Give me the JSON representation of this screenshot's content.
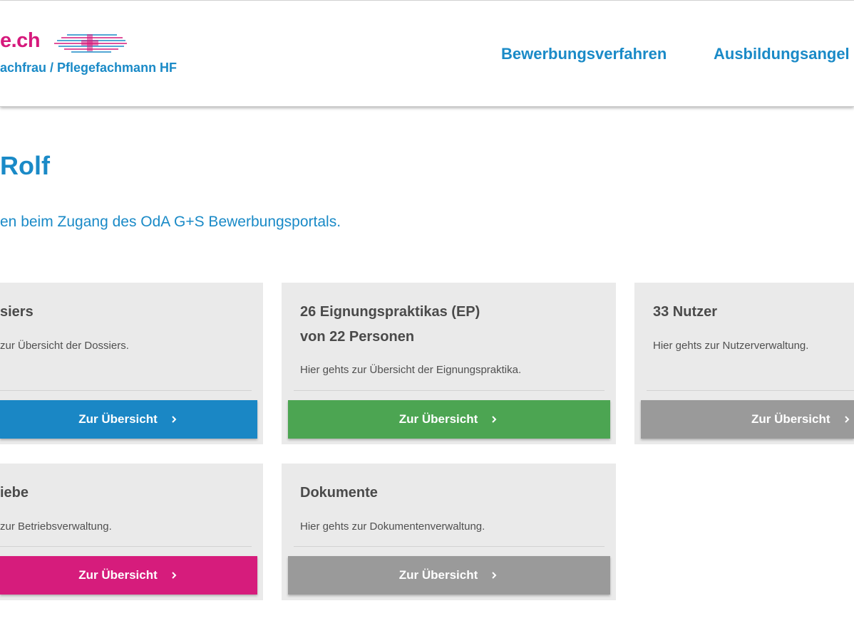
{
  "header": {
    "logo_text": "e.ch",
    "logo_subtitle": "achfrau / Pflegefachmann HF",
    "nav": [
      {
        "label": "Bewerbungsverfahren"
      },
      {
        "label": "Ausbildungsangel"
      }
    ]
  },
  "greeting": "Rolf",
  "intro": "en beim Zugang des OdA G+S Bewerbungsportals.",
  "cards": [
    {
      "title": "siers",
      "title2": "",
      "desc": "zur Übersicht der Dossiers.",
      "button": "Zur Übersicht",
      "color": "#1a87c5"
    },
    {
      "title": "26 Eignungspraktikas (EP)",
      "title2": "von 22 Personen",
      "desc": "Hier gehts zur Übersicht der Eignungspraktika.",
      "button": "Zur Übersicht",
      "color": "#4ca552"
    },
    {
      "title": "33 Nutzer",
      "title2": "",
      "desc": "Hier gehts zur Nutzerverwaltung.",
      "button": "Zur Übersicht",
      "color": "#9a9a9a"
    },
    {
      "title": "iebe",
      "title2": "",
      "desc": "zur Betriebsverwaltung.",
      "button": "Zur Übersicht",
      "color": "#d61c7c"
    },
    {
      "title": "Dokumente",
      "title2": "",
      "desc": "Hier gehts zur Dokumentenverwaltung.",
      "button": "Zur Übersicht",
      "color": "#9a9a9a"
    }
  ],
  "icons": {
    "button_icon": "chevron-right-icon",
    "logo_icon": "swiss-cross-lines-icon"
  }
}
